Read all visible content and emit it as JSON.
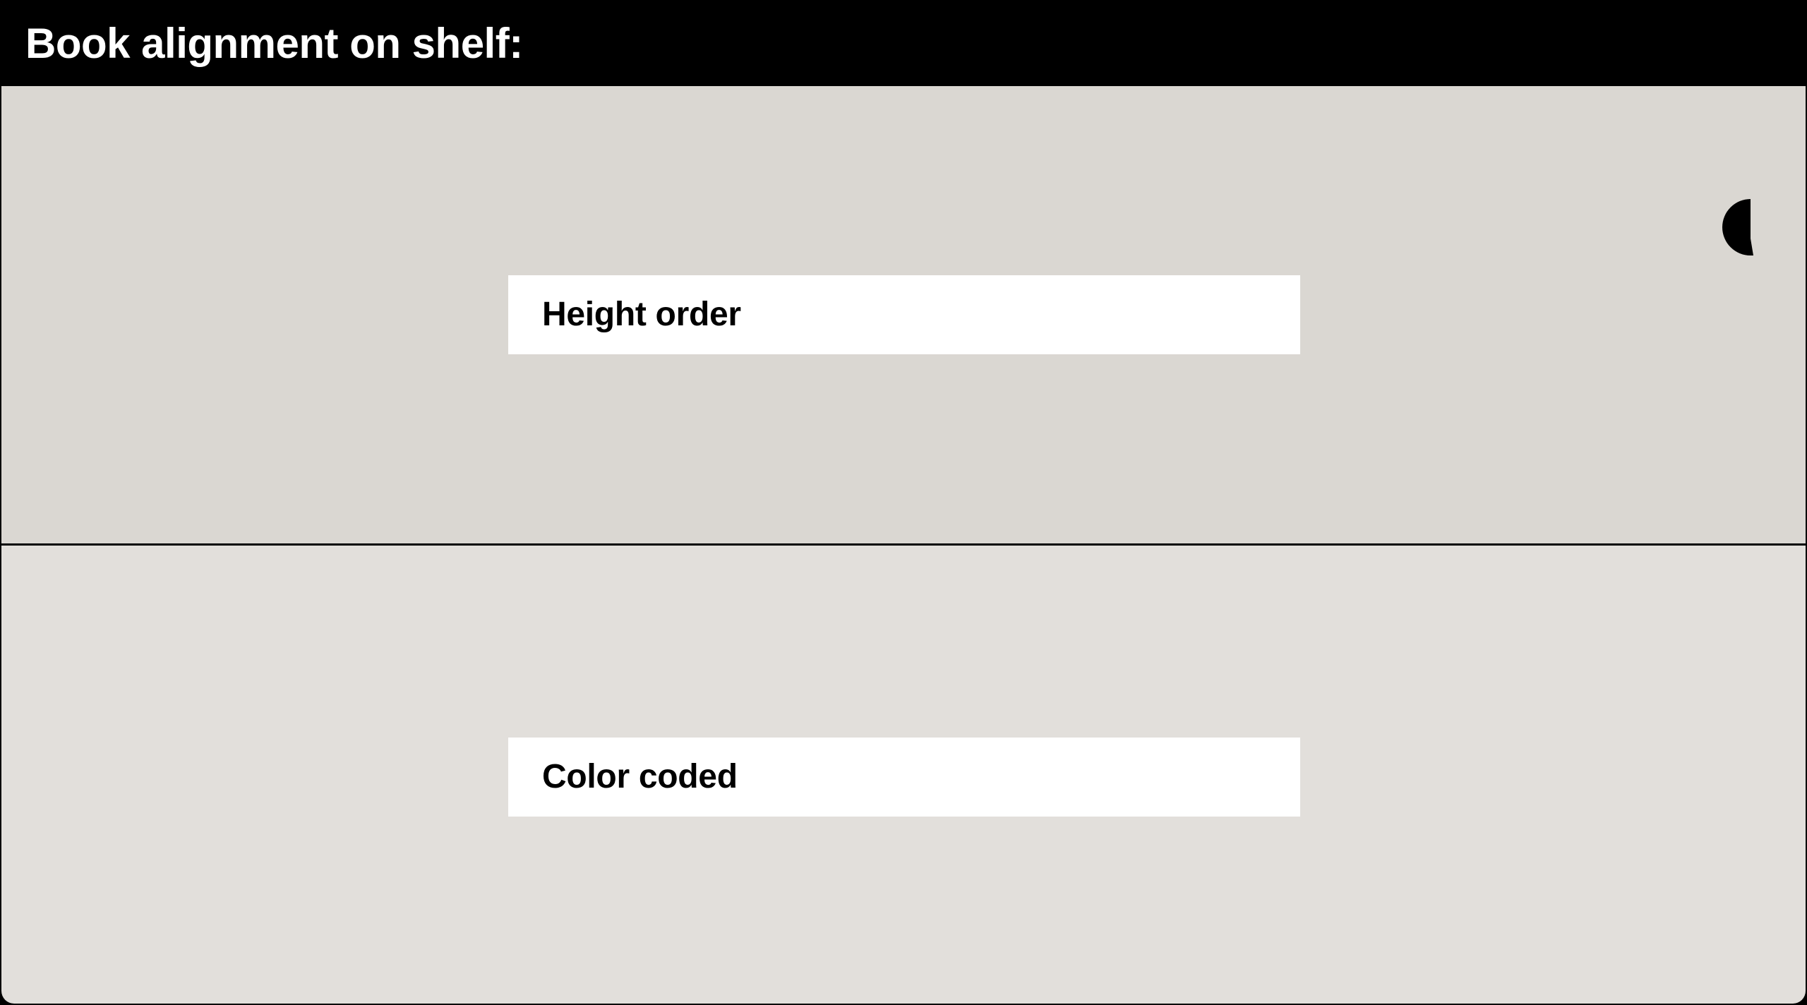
{
  "header": {
    "title": "Book alignment on shelf:"
  },
  "options": [
    {
      "label": "Height order"
    },
    {
      "label": "Color coded"
    }
  ],
  "theme_toggle": {
    "icon": "contrast-icon"
  },
  "colors": {
    "header_bg": "#000000",
    "header_text": "#ffffff",
    "top_panel_bg": "#dad7d2",
    "bottom_panel_bg": "#e2dfdb",
    "card_bg": "#ffffff",
    "card_text": "#000000"
  }
}
